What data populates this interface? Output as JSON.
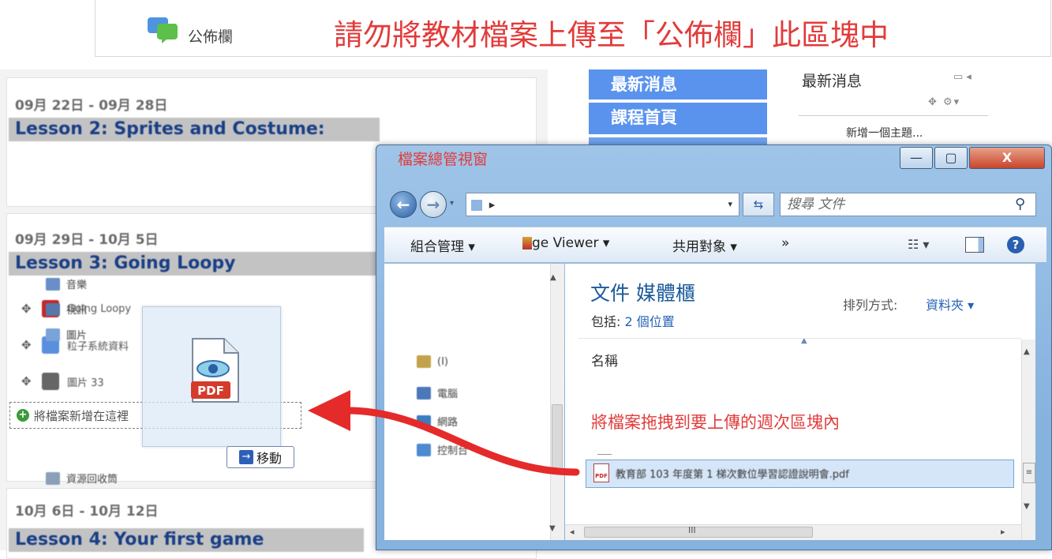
{
  "announcement": {
    "forum_label": "公佈欄",
    "note": "請勿將教材檔案上傳至「公佈欄」此區塊中"
  },
  "course": {
    "weeks": [
      {
        "date": "09月 22日 - 09月 28日",
        "title": "Lesson 2: Sprites and Costume:"
      },
      {
        "date": "09月 29日 - 10月 5日",
        "title": "Lesson 3: Going Loopy"
      },
      {
        "date": "10月 6日 - 10月 12日",
        "title": "Lesson 4: Your first game"
      }
    ],
    "activities": [
      {
        "label": "Going Loopy"
      },
      {
        "label": "粒子系統資料"
      },
      {
        "label": "圖片 33"
      }
    ],
    "add_file_label": "將檔案新增在這裡",
    "move_button_label": "移動",
    "drag_icon_label": "PDF"
  },
  "right_nav": {
    "blocks": [
      "最新消息",
      "課程首頁",
      "",
      ""
    ],
    "news": {
      "title": "最新消息",
      "add_topic": "新增一個主題..."
    }
  },
  "explorer": {
    "window_title": "檔案總管視窗",
    "address_path": "▸ ",
    "search_placeholder": "搜尋 文件",
    "toolbar": {
      "organize": "組合管理 ▾",
      "image_viewer": "ge Viewer ▾",
      "share": "共用對象 ▾",
      "more": "»"
    },
    "nav_items": [
      {
        "label": "音樂",
        "color": "#6a8fc8"
      },
      {
        "label": "視訊",
        "color": "#5577aa"
      },
      {
        "label": "圖片",
        "color": "#7aa3d8"
      },
      {
        "label": "(I)",
        "color": "#c4a24a"
      },
      {
        "label": "電腦",
        "color": "#4a78b8"
      },
      {
        "label": "網路",
        "color": "#3a7cc0"
      },
      {
        "label": "控制台",
        "color": "#4d8ad0"
      },
      {
        "label": "資源回收筒",
        "color": "#8aa0b8"
      }
    ],
    "library": {
      "title": "文件 媒體櫃",
      "includes_prefix": "包括: ",
      "includes_link": "2 個位置",
      "sort_label": "排列方式:",
      "sort_value": "資料夾 ▾",
      "column_name": "名稱",
      "file_name": "教育部 103 年度第 1 梯次數位學習認證說明會.pdf"
    },
    "instruction": "將檔案拖拽到要上傳的週次區塊內",
    "window_buttons": {
      "minimize": "—",
      "maximize": "▢",
      "close": "X"
    }
  }
}
